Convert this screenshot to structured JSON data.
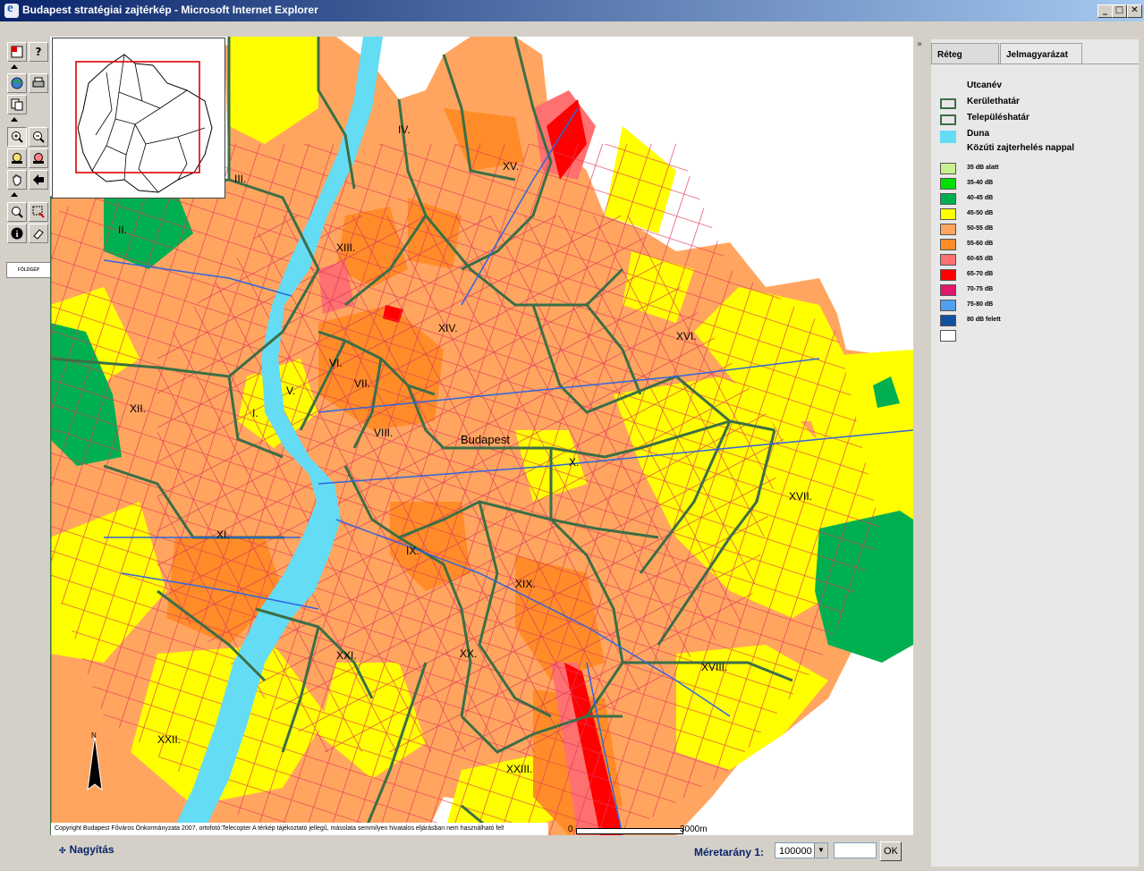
{
  "window": {
    "title": "Budapest stratégiai zajtérkép - Microsoft Internet Explorer",
    "minimize_glyph": "_",
    "maximize_glyph": "□",
    "close_glyph": "✕"
  },
  "toolbar": {
    "tools": [
      "layers-icon",
      "help-icon",
      "globe-icon",
      "print-icon",
      "copy-icon",
      "zoom-in-icon",
      "zoom-out-icon",
      "zoom-prev-icon",
      "zoom-next-icon",
      "pan-hand-icon",
      "back-arrow-icon",
      "magnifier-icon",
      "select-rectangle-icon",
      "info-icon",
      "eraser-icon"
    ],
    "help_glyph": "?",
    "info_glyph": "i",
    "logo_text": "FÖLDGÉP"
  },
  "map": {
    "city_label": "Budapest",
    "districts": [
      "I.",
      "II.",
      "III.",
      "IV.",
      "V.",
      "VI.",
      "VII.",
      "VIII.",
      "IX.",
      "X.",
      "XI.",
      "XII.",
      "XIII.",
      "XIV.",
      "XV.",
      "XVI.",
      "XVII.",
      "XVIII.",
      "XIX.",
      "XX.",
      "XXI.",
      "XXII.",
      "XXIII."
    ],
    "north_label": "N",
    "colors": {
      "low": "#c8f08c",
      "yellow": "#ffff00",
      "light_orange": "#ffa560",
      "orange": "#ff8c28",
      "salmon": "#ff7070",
      "red": "#ff0000",
      "crimson": "#e0186e",
      "green": "#00b050",
      "river": "#64dcf4",
      "border": "#3c6e46",
      "road_blue": "#3264dc"
    },
    "copyright": "Copyright Budapest Főváros Önkormányzata 2007, ortofotó:Telecopter A térkép tájékoztató jellegű, másolata semmilyen hivatalos eljárásban nem használható fel!",
    "scale_start": "0",
    "scale_end": "3000m"
  },
  "bottom": {
    "zoom_link": "Nagyítás",
    "ratio_label": "Méretarány 1:",
    "ratio_value": "100000",
    "ratio_input": "",
    "ok_label": "OK"
  },
  "panel": {
    "tabs": [
      "Réteg",
      "Jelmagyarázat"
    ],
    "active_tab": "Jelmagyarázat",
    "collapse_glyph": "»",
    "legend_layers": [
      {
        "label": "Utcanév",
        "kind": "none"
      },
      {
        "label": "Kerülethatár",
        "kind": "outline",
        "color": "#3c6e46"
      },
      {
        "label": "Településhatár",
        "kind": "outline",
        "color": "#3c6e46"
      },
      {
        "label": "Duna",
        "kind": "fill",
        "color": "#64dcf4"
      },
      {
        "label": "Közúti zajterhelés nappal",
        "kind": "none"
      }
    ],
    "noise_classes": [
      {
        "label": "35 dB alatt",
        "color": "#c8f08c"
      },
      {
        "label": "35-40 dB",
        "color": "#00e000"
      },
      {
        "label": "40-45 dB",
        "color": "#00b050"
      },
      {
        "label": "45-50 dB",
        "color": "#ffff00"
      },
      {
        "label": "50-55 dB",
        "color": "#ffa560"
      },
      {
        "label": "55-60 dB",
        "color": "#ff8c28"
      },
      {
        "label": "60-65 dB",
        "color": "#ff7070"
      },
      {
        "label": "65-70 dB",
        "color": "#ff0000"
      },
      {
        "label": "70-75 dB",
        "color": "#e0186e"
      },
      {
        "label": "75-80 dB",
        "color": "#50a0f0"
      },
      {
        "label": "80 dB felett",
        "color": "#1450a0"
      },
      {
        "label": "",
        "color": "#ffffff"
      }
    ]
  }
}
